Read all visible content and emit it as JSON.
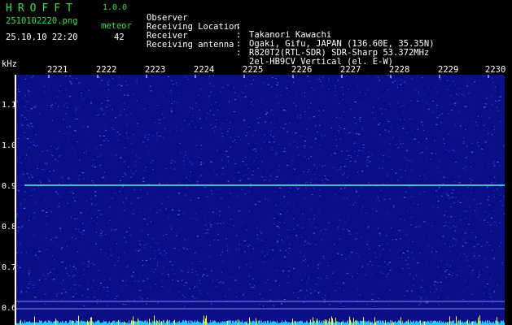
{
  "header": {
    "logo": "HROFFT",
    "version": "1.0.0",
    "filename": "2510102220.png",
    "meteor_label": "meteor",
    "datetime": "25.10.10 22:20",
    "meteor_count": "42"
  },
  "info": [
    {
      "key": "Observer",
      "colon": ":",
      "value": "Takanori Kawachi"
    },
    {
      "key": "Receiving Location",
      "colon": ":",
      "value": "Ogaki, Gifu, JAPAN (136.60E, 35.35N)"
    },
    {
      "key": "Receiver",
      "colon": ":",
      "value": "R820T2(RTL-SDR) SDR-Sharp 53.372MHz"
    },
    {
      "key": "Receiving antenna",
      "colon": ":",
      "value": "2el-HB9CV Vertical (el. E-W)"
    }
  ],
  "axes": {
    "y_unit": "kHz",
    "y_ticks": [
      "1.1",
      "1.0",
      "0.9",
      "0.8",
      "0.7",
      "0.6"
    ],
    "x_ticks": [
      "2221",
      "2222",
      "2223",
      "2224",
      "2225",
      "2226",
      "2227",
      "2228",
      "2229",
      "2230"
    ]
  },
  "colors": {
    "background": "#000000",
    "spectrum_base": "#0a0f88",
    "signal_line": "#4fd8d0",
    "bottom_trace": "#22c8ff",
    "bottom_spikes": "#ffff22",
    "label_green": "#35e04a",
    "label_white": "#ffffff"
  }
}
